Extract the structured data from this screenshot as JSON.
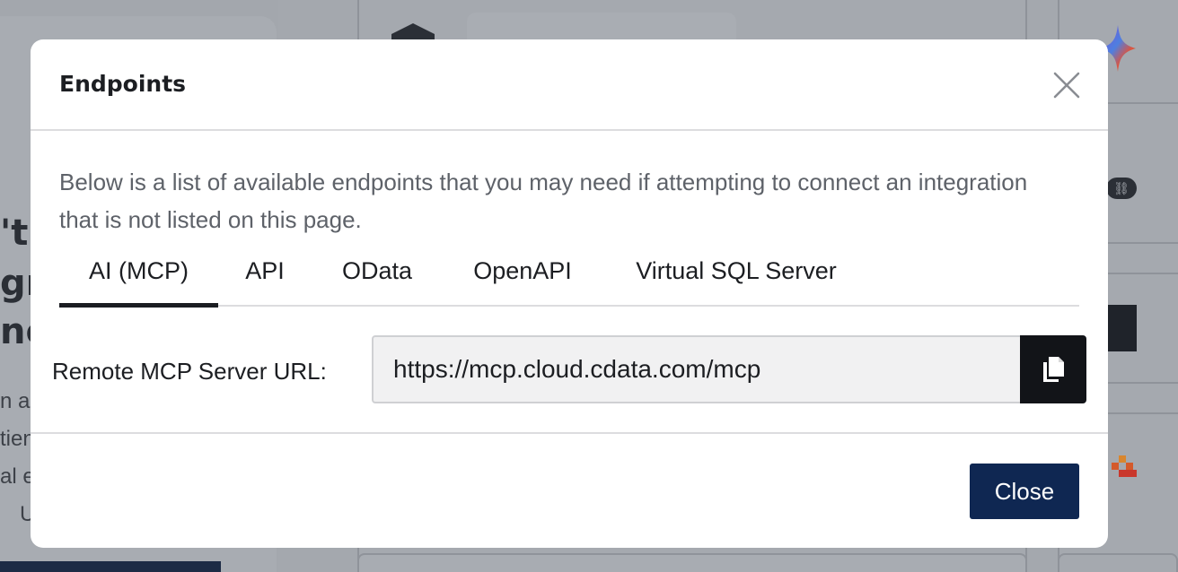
{
  "modal": {
    "title": "Endpoints",
    "description": "Below is a list of available endpoints that you may need if attempting to connect an integration that is not listed on this page.",
    "tabs": [
      {
        "label": "AI (MCP)",
        "active": true
      },
      {
        "label": "API",
        "active": false
      },
      {
        "label": "OData",
        "active": false
      },
      {
        "label": "OpenAPI",
        "active": false
      },
      {
        "label": "Virtual SQL Server",
        "active": false
      }
    ],
    "field": {
      "label": "Remote MCP Server URL:",
      "value": "https://mcp.cloud.cdata.com/mcp"
    },
    "close_label": "Close",
    "icons": {
      "close": "close-icon",
      "copy": "copy-icon"
    }
  },
  "background": {
    "heading_lines": [
      "'t",
      "gra",
      "ne"
    ],
    "body_lines": [
      "n al",
      "tien",
      "al e",
      "U"
    ]
  },
  "colors": {
    "overlay": "#a4a8ae",
    "primary_button": "#0f2752",
    "copy_button": "#121418",
    "active_tab_underline": "#1b1d22",
    "muted_text": "#5e6269"
  }
}
